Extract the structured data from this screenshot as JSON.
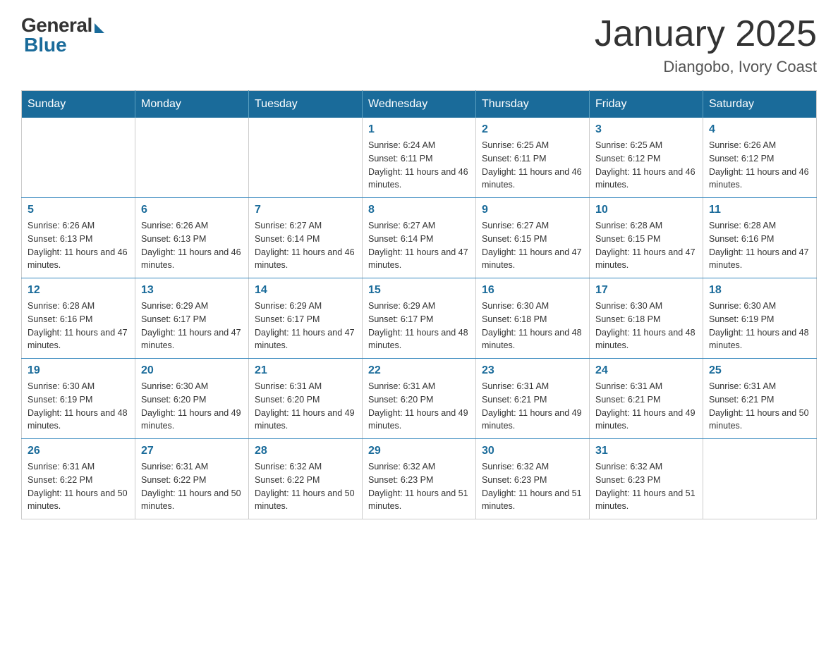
{
  "logo": {
    "general": "General",
    "blue": "Blue"
  },
  "title": "January 2025",
  "location": "Diangobo, Ivory Coast",
  "days_of_week": [
    "Sunday",
    "Monday",
    "Tuesday",
    "Wednesday",
    "Thursday",
    "Friday",
    "Saturday"
  ],
  "weeks": [
    [
      {
        "day": "",
        "info": ""
      },
      {
        "day": "",
        "info": ""
      },
      {
        "day": "",
        "info": ""
      },
      {
        "day": "1",
        "info": "Sunrise: 6:24 AM\nSunset: 6:11 PM\nDaylight: 11 hours and 46 minutes."
      },
      {
        "day": "2",
        "info": "Sunrise: 6:25 AM\nSunset: 6:11 PM\nDaylight: 11 hours and 46 minutes."
      },
      {
        "day": "3",
        "info": "Sunrise: 6:25 AM\nSunset: 6:12 PM\nDaylight: 11 hours and 46 minutes."
      },
      {
        "day": "4",
        "info": "Sunrise: 6:26 AM\nSunset: 6:12 PM\nDaylight: 11 hours and 46 minutes."
      }
    ],
    [
      {
        "day": "5",
        "info": "Sunrise: 6:26 AM\nSunset: 6:13 PM\nDaylight: 11 hours and 46 minutes."
      },
      {
        "day": "6",
        "info": "Sunrise: 6:26 AM\nSunset: 6:13 PM\nDaylight: 11 hours and 46 minutes."
      },
      {
        "day": "7",
        "info": "Sunrise: 6:27 AM\nSunset: 6:14 PM\nDaylight: 11 hours and 46 minutes."
      },
      {
        "day": "8",
        "info": "Sunrise: 6:27 AM\nSunset: 6:14 PM\nDaylight: 11 hours and 47 minutes."
      },
      {
        "day": "9",
        "info": "Sunrise: 6:27 AM\nSunset: 6:15 PM\nDaylight: 11 hours and 47 minutes."
      },
      {
        "day": "10",
        "info": "Sunrise: 6:28 AM\nSunset: 6:15 PM\nDaylight: 11 hours and 47 minutes."
      },
      {
        "day": "11",
        "info": "Sunrise: 6:28 AM\nSunset: 6:16 PM\nDaylight: 11 hours and 47 minutes."
      }
    ],
    [
      {
        "day": "12",
        "info": "Sunrise: 6:28 AM\nSunset: 6:16 PM\nDaylight: 11 hours and 47 minutes."
      },
      {
        "day": "13",
        "info": "Sunrise: 6:29 AM\nSunset: 6:17 PM\nDaylight: 11 hours and 47 minutes."
      },
      {
        "day": "14",
        "info": "Sunrise: 6:29 AM\nSunset: 6:17 PM\nDaylight: 11 hours and 47 minutes."
      },
      {
        "day": "15",
        "info": "Sunrise: 6:29 AM\nSunset: 6:17 PM\nDaylight: 11 hours and 48 minutes."
      },
      {
        "day": "16",
        "info": "Sunrise: 6:30 AM\nSunset: 6:18 PM\nDaylight: 11 hours and 48 minutes."
      },
      {
        "day": "17",
        "info": "Sunrise: 6:30 AM\nSunset: 6:18 PM\nDaylight: 11 hours and 48 minutes."
      },
      {
        "day": "18",
        "info": "Sunrise: 6:30 AM\nSunset: 6:19 PM\nDaylight: 11 hours and 48 minutes."
      }
    ],
    [
      {
        "day": "19",
        "info": "Sunrise: 6:30 AM\nSunset: 6:19 PM\nDaylight: 11 hours and 48 minutes."
      },
      {
        "day": "20",
        "info": "Sunrise: 6:30 AM\nSunset: 6:20 PM\nDaylight: 11 hours and 49 minutes."
      },
      {
        "day": "21",
        "info": "Sunrise: 6:31 AM\nSunset: 6:20 PM\nDaylight: 11 hours and 49 minutes."
      },
      {
        "day": "22",
        "info": "Sunrise: 6:31 AM\nSunset: 6:20 PM\nDaylight: 11 hours and 49 minutes."
      },
      {
        "day": "23",
        "info": "Sunrise: 6:31 AM\nSunset: 6:21 PM\nDaylight: 11 hours and 49 minutes."
      },
      {
        "day": "24",
        "info": "Sunrise: 6:31 AM\nSunset: 6:21 PM\nDaylight: 11 hours and 49 minutes."
      },
      {
        "day": "25",
        "info": "Sunrise: 6:31 AM\nSunset: 6:21 PM\nDaylight: 11 hours and 50 minutes."
      }
    ],
    [
      {
        "day": "26",
        "info": "Sunrise: 6:31 AM\nSunset: 6:22 PM\nDaylight: 11 hours and 50 minutes."
      },
      {
        "day": "27",
        "info": "Sunrise: 6:31 AM\nSunset: 6:22 PM\nDaylight: 11 hours and 50 minutes."
      },
      {
        "day": "28",
        "info": "Sunrise: 6:32 AM\nSunset: 6:22 PM\nDaylight: 11 hours and 50 minutes."
      },
      {
        "day": "29",
        "info": "Sunrise: 6:32 AM\nSunset: 6:23 PM\nDaylight: 11 hours and 51 minutes."
      },
      {
        "day": "30",
        "info": "Sunrise: 6:32 AM\nSunset: 6:23 PM\nDaylight: 11 hours and 51 minutes."
      },
      {
        "day": "31",
        "info": "Sunrise: 6:32 AM\nSunset: 6:23 PM\nDaylight: 11 hours and 51 minutes."
      },
      {
        "day": "",
        "info": ""
      }
    ]
  ]
}
